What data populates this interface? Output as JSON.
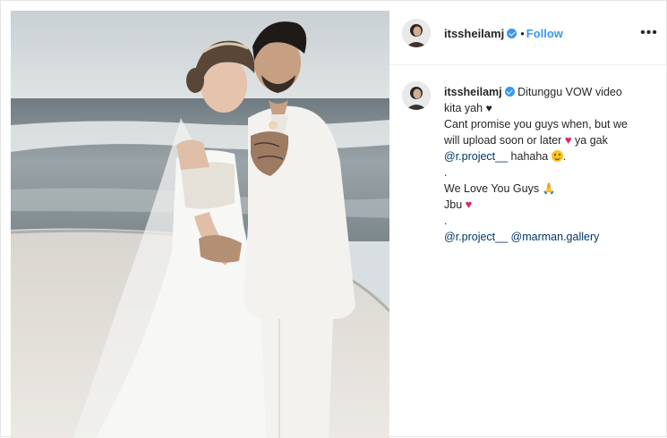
{
  "post": {
    "username": "itssheilamj",
    "follow_label": "Follow",
    "separator": "•",
    "more_label": "•••",
    "photo": {
      "icon": "wedding-photo"
    },
    "caption": {
      "line1": "Ditunggu VOW video",
      "line2": "kita yah",
      "line3": "Cant promise you guys when, but we",
      "line4": "will upload soon or later",
      "line4b": "ya gak",
      "mention1": "@r.project__",
      "line5b": "hahaha",
      "dot1": ".",
      "line6": "We Love You Guys",
      "line7": "Jbu",
      "dot2": ".",
      "mention2": "@r.project__",
      "mention3": "@marman.gallery"
    },
    "emojis": {
      "heart_black": "♥",
      "heart_red": "♥",
      "pray": "🙏"
    },
    "colors": {
      "accent": "#3897f0",
      "link": "#00376b",
      "heart": "#e0245e",
      "text": "#262626"
    }
  }
}
